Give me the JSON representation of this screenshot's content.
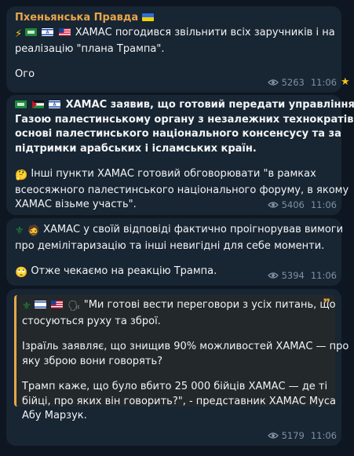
{
  "channel": {
    "name": "Пхеньянська Правда"
  },
  "messages": [
    {
      "line1": "ХАМАС погодився звільнити всіх заручників і на",
      "line2": "реалізацію \"плана Трампа\".",
      "line3": "Ого",
      "views": "5263",
      "time": "11:06"
    },
    {
      "l1": "ХАМАС заявив, що готовий передати управління",
      "l2": "Газою палестинському органу з незалежних технократів на",
      "l3": "основі палестинського національного консенсусу та за",
      "l4": "підтримки арабських і ісламських країн.",
      "l5": "Інші пункти ХАМАС готовий обговорювати \"в рамках",
      "l6": "всеосяжного палестинського національного форуму, в якому",
      "l7": "ХАМАС візьме участь\".",
      "views": "5406",
      "time": "11:06"
    },
    {
      "l1": "ХАМАС у своїй відповіді фактично проігнорував вимоги",
      "l2": "про демілітаризацію та інші невигідні для себе моменти.",
      "l3": "Отже чекаємо на реакцію Трампа.",
      "views": "5394",
      "time": "11:06"
    },
    {
      "q1": "\"Ми готові вести переговори з усіх питань, що",
      "q2": "стосуються руху та зброї.",
      "q3": "Ізраїль заявляє, що знищив 90% можливостей ХАМАС — про",
      "q4": "яку зброю вони говорять?",
      "q5": "Трамп каже, що було вбито 25 000 бійців ХАМАС — де ті",
      "q6": "бійці, про яких він говорить?\", - представник ХАМАС Муса",
      "q7": "Абу Марзук.",
      "views": "5179",
      "time": "11:06"
    }
  ]
}
